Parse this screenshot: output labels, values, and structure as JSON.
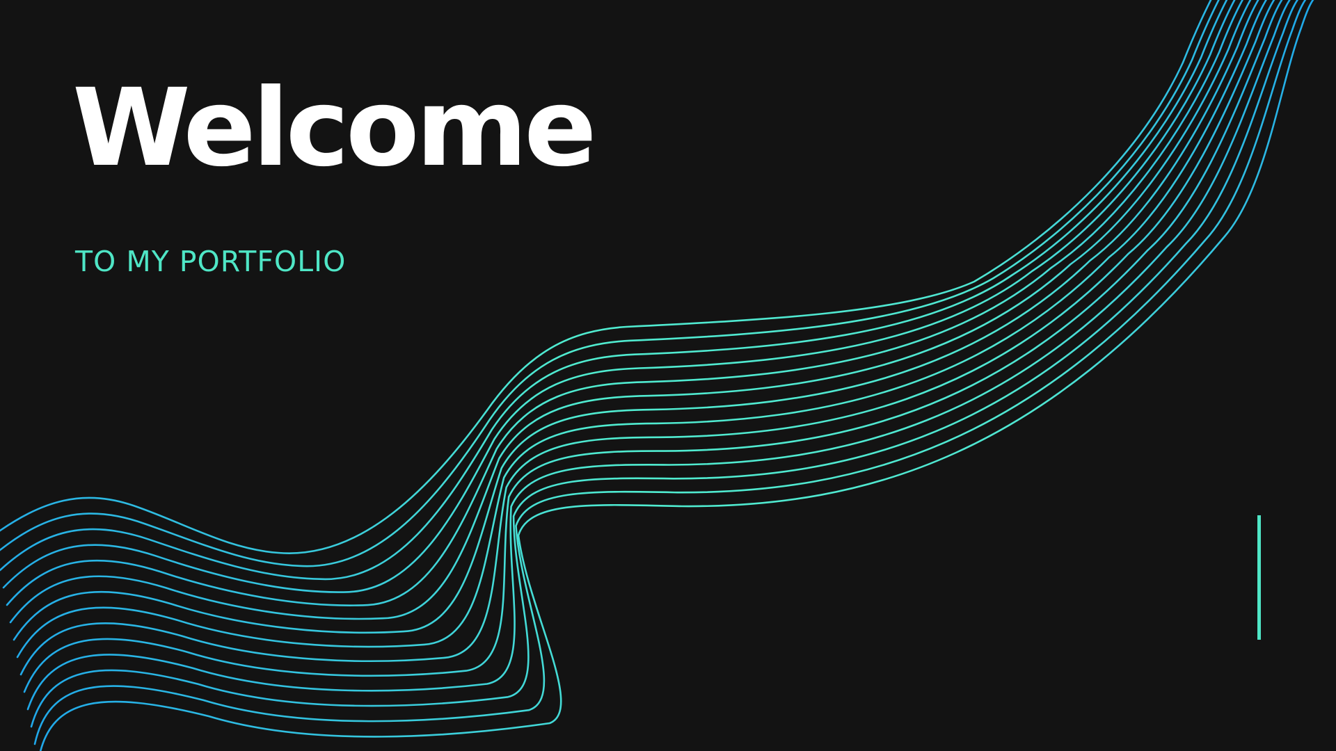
{
  "slide": {
    "title": "Welcome",
    "subtitle": "TO MY PORTFOLIO"
  },
  "colors": {
    "background": "#131313",
    "title": "#ffffff",
    "accent": "#4fe6c6",
    "wave_blue": "#1fa6ea",
    "wave_teal": "#50ecd0"
  }
}
